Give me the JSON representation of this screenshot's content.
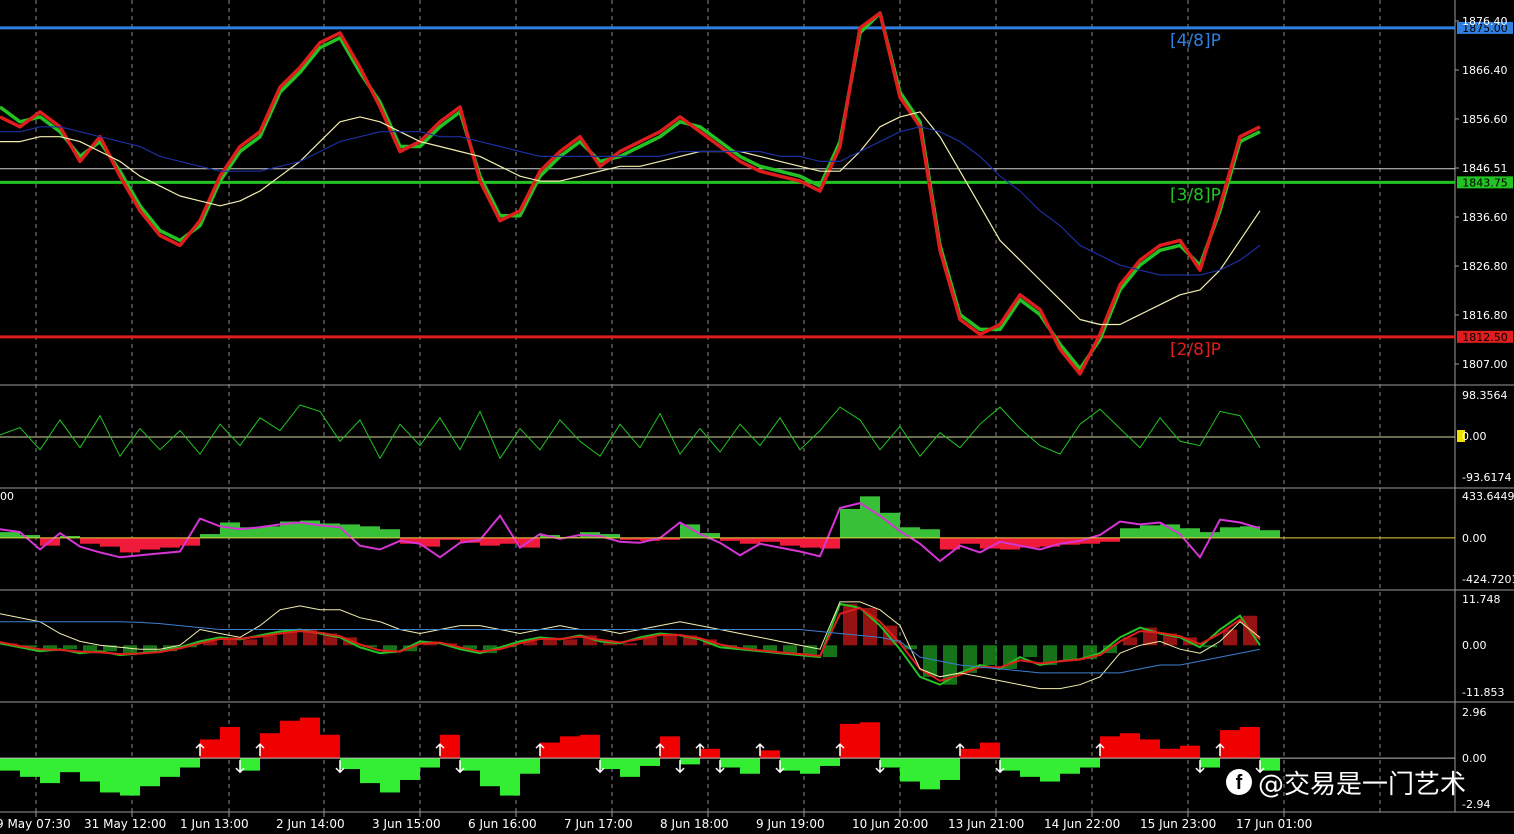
{
  "chart_data": [
    {
      "type": "line",
      "panel": "price",
      "ylim": [
        1800.5,
        1879
      ],
      "y_ticks": [
        "1876.40",
        "1866.40",
        "1856.60",
        "1846.51",
        "1836.60",
        "1826.80",
        "1816.80",
        "1807.00"
      ],
      "current_price": "1846.51",
      "grid": true,
      "levels": [
        {
          "label": "[4/8]P",
          "value": 1875.0,
          "tag": "1875.00",
          "color": "#2f7fe0"
        },
        {
          "label": "[3/8]P",
          "value": 1843.75,
          "tag": "1843.75",
          "color": "#22c322"
        },
        {
          "label": "[2/8]P",
          "value": 1812.5,
          "tag": "1812.50",
          "color": "#e01d1d"
        }
      ],
      "x": [
        0,
        20,
        40,
        60,
        80,
        100,
        120,
        140,
        160,
        180,
        200,
        220,
        240,
        260,
        280,
        300,
        320,
        340,
        360,
        380,
        400,
        420,
        440,
        460,
        480,
        500,
        520,
        540,
        560,
        580,
        600,
        620,
        640,
        660,
        680,
        700,
        720,
        740,
        760,
        780,
        800,
        820,
        840,
        860,
        880,
        900,
        920,
        940,
        960,
        980,
        1000,
        1020,
        1040,
        1060,
        1080,
        1100,
        1120,
        1140,
        1160,
        1180,
        1200,
        1220,
        1240,
        1260
      ],
      "series": [
        {
          "color": "#22c322",
          "values": [
            1859,
            1856,
            1857,
            1854,
            1849,
            1852,
            1846,
            1839,
            1834,
            1832,
            1835,
            1844,
            1850,
            1853,
            1862,
            1866,
            1871,
            1873,
            1866,
            1860,
            1851,
            1851,
            1855,
            1858,
            1845,
            1837,
            1837,
            1845,
            1849,
            1852,
            1848,
            1849,
            1851,
            1853,
            1856,
            1855,
            1852,
            1849,
            1847,
            1846,
            1845,
            1843,
            1852,
            1874,
            1878,
            1862,
            1856,
            1831,
            1817,
            1814,
            1814,
            1820,
            1817,
            1811,
            1806,
            1812,
            1822,
            1827,
            1830,
            1831,
            1827,
            1838,
            1852,
            1854
          ]
        },
        {
          "color": "#e01d1d",
          "values": [
            1857,
            1855,
            1858,
            1855,
            1848,
            1853,
            1845,
            1838,
            1833,
            1831,
            1836,
            1845,
            1851,
            1854,
            1863,
            1867,
            1872,
            1874,
            1867,
            1859,
            1850,
            1852,
            1856,
            1859,
            1844,
            1836,
            1838,
            1846,
            1850,
            1853,
            1847,
            1850,
            1852,
            1854,
            1857,
            1854,
            1851,
            1848,
            1846,
            1845,
            1844,
            1842,
            1851,
            1875,
            1878,
            1861,
            1855,
            1830,
            1816,
            1813,
            1815,
            1821,
            1818,
            1810,
            1805,
            1813,
            1823,
            1828,
            1831,
            1832,
            1826,
            1839,
            1853,
            1855
          ]
        },
        {
          "color": "#f4efb0",
          "values": [
            1852,
            1852,
            1853,
            1853,
            1852,
            1850,
            1848,
            1845,
            1843,
            1841,
            1840,
            1839,
            1840,
            1842,
            1845,
            1848,
            1852,
            1856,
            1857,
            1856,
            1854,
            1852,
            1851,
            1850,
            1849,
            1847,
            1845,
            1844,
            1844,
            1845,
            1846,
            1847,
            1847,
            1848,
            1849,
            1850,
            1850,
            1850,
            1849,
            1848,
            1847,
            1846,
            1846,
            1850,
            1855,
            1857,
            1858,
            1853,
            1846,
            1839,
            1832,
            1828,
            1824,
            1820,
            1816,
            1815,
            1815,
            1817,
            1819,
            1821,
            1822,
            1826,
            1832,
            1838
          ]
        },
        {
          "color": "#1c2e9e",
          "values": [
            1854,
            1854,
            1855,
            1855,
            1854,
            1853,
            1852,
            1851,
            1849,
            1848,
            1847,
            1846,
            1846,
            1846,
            1847,
            1848,
            1850,
            1852,
            1853,
            1854,
            1854,
            1854,
            1853,
            1853,
            1852,
            1851,
            1850,
            1849,
            1849,
            1849,
            1849,
            1849,
            1849,
            1849,
            1850,
            1850,
            1850,
            1850,
            1850,
            1849,
            1849,
            1848,
            1848,
            1850,
            1852,
            1854,
            1855,
            1854,
            1852,
            1849,
            1845,
            1842,
            1838,
            1835,
            1831,
            1829,
            1827,
            1826,
            1825,
            1825,
            1825,
            1826,
            1828,
            1831
          ]
        }
      ]
    },
    {
      "type": "line",
      "panel": "oscillator-1",
      "ylim": [
        -93.6174,
        98.3564
      ],
      "y_ticks": [
        "98.3564",
        "0.00",
        "-93.6174"
      ],
      "series": [
        {
          "color": "#22c322",
          "values": [
            5,
            22,
            -30,
            40,
            -25,
            50,
            -45,
            20,
            -30,
            15,
            -40,
            30,
            -20,
            45,
            15,
            75,
            60,
            -10,
            40,
            -50,
            30,
            -20,
            45,
            -30,
            60,
            -50,
            20,
            -30,
            40,
            -10,
            -45,
            30,
            -25,
            55,
            -40,
            20,
            -35,
            30,
            -20,
            45,
            -30,
            15,
            70,
            40,
            -30,
            25,
            -45,
            10,
            -25,
            30,
            70,
            20,
            -20,
            -40,
            30,
            65,
            20,
            -25,
            45,
            -10,
            -20,
            60,
            50,
            -25
          ]
        }
      ]
    },
    {
      "type": "area",
      "panel": "oscillator-2",
      "ylim": [
        -424.7201,
        433.6449
      ],
      "y_ticks": [
        "433.6449",
        "0.00",
        "-424.7201"
      ],
      "left_edge_label": "00",
      "series": [
        {
          "color": "#22c322",
          "values": [
            60,
            30,
            -80,
            20,
            -60,
            -90,
            -150,
            -120,
            -100,
            -80,
            40,
            160,
            110,
            120,
            170,
            180,
            150,
            140,
            120,
            90,
            -60,
            -90,
            -20,
            -50,
            -80,
            -60,
            -100,
            30,
            10,
            60,
            40,
            -20,
            -30,
            -20,
            140,
            50,
            -30,
            -60,
            -40,
            -80,
            -100,
            -110,
            300,
            430,
            260,
            110,
            90,
            -120,
            -60,
            -110,
            -120,
            -100,
            -90,
            -70,
            -60,
            -40,
            100,
            130,
            140,
            100,
            60,
            110,
            120,
            80
          ]
        },
        {
          "color": "#d535d5",
          "values": [
            90,
            60,
            -120,
            50,
            -90,
            -150,
            -200,
            -180,
            -160,
            -140,
            200,
            120,
            90,
            110,
            140,
            160,
            130,
            110,
            -80,
            -120,
            -30,
            -60,
            -200,
            -50,
            -20,
            230,
            -100,
            40,
            -10,
            30,
            20,
            -40,
            -50,
            0,
            160,
            40,
            -50,
            -180,
            -60,
            -100,
            -140,
            -190,
            310,
            360,
            230,
            70,
            -60,
            -240,
            -80,
            -150,
            -40,
            -80,
            -120,
            -60,
            -30,
            30,
            170,
            140,
            160,
            40,
            -200,
            190,
            160,
            100
          ]
        }
      ]
    },
    {
      "type": "line",
      "panel": "oscillator-3",
      "ylim": [
        -11.853,
        11.748
      ],
      "y_ticks": [
        "11.748",
        "0.00",
        "-11.853"
      ],
      "series": [
        {
          "color": "#22c322",
          "values": [
            0.5,
            -0.5,
            -1.5,
            -1,
            -2,
            -1.5,
            -2.5,
            -2,
            -1.5,
            -0.5,
            1,
            2,
            1.5,
            2.5,
            3.5,
            4,
            3,
            2,
            -0.5,
            -2,
            -1.5,
            1,
            0.5,
            -1,
            -2,
            -0.5,
            1,
            2,
            1.5,
            2.5,
            1,
            0.5,
            2,
            3,
            2.5,
            1.5,
            -0.5,
            -1,
            -1.5,
            -2,
            -2.5,
            -3,
            10.5,
            9.5,
            5,
            -1,
            -8,
            -10,
            -7,
            -5,
            -6,
            -3,
            -5,
            -4,
            -3.5,
            -2,
            2,
            4.5,
            3,
            2,
            -0.5,
            4,
            7.5,
            0
          ]
        },
        {
          "color": "#e01d1d",
          "values": [
            0.8,
            -0.2,
            -1,
            -1.2,
            -1.6,
            -1.8,
            -2.2,
            -2.1,
            -1.7,
            -0.8,
            0.5,
            1.6,
            1.7,
            2.2,
            3,
            3.6,
            3.2,
            2.3,
            0.2,
            -1.3,
            -1.6,
            0.4,
            0.7,
            -0.5,
            -1.6,
            -1,
            0.5,
            1.6,
            1.6,
            2.2,
            1.4,
            0.7,
            1.6,
            2.6,
            2.6,
            1.8,
            0.2,
            -0.7,
            -1.3,
            -1.8,
            -2.2,
            -2.7,
            8,
            9.5,
            6,
            0.5,
            -6,
            -9,
            -7.5,
            -5.5,
            -5.6,
            -3.8,
            -4.6,
            -4.1,
            -3.6,
            -2.5,
            1,
            3.6,
            3.2,
            2.3,
            0.3,
            3,
            6.5,
            1.5
          ]
        },
        {
          "color": "#f4efb0",
          "values": [
            8,
            7,
            6,
            3,
            1,
            0,
            -0.5,
            -1,
            -1,
            0,
            4,
            3,
            2,
            5,
            9,
            10,
            9,
            9,
            7,
            6,
            4,
            3,
            4,
            5,
            5,
            4,
            3,
            4,
            5,
            4,
            4,
            3,
            4,
            5,
            6,
            5,
            4,
            3,
            2,
            1,
            0,
            -1,
            11,
            11,
            9,
            5,
            -6,
            -8,
            -7,
            -8,
            -9,
            -10,
            -11,
            -11,
            -10,
            -8,
            -2,
            0,
            1,
            -1,
            -2,
            1,
            6,
            2
          ]
        },
        {
          "color": "#3a7fd0",
          "values": [
            6,
            6,
            6,
            6,
            6,
            6,
            6,
            5.8,
            5.5,
            5,
            4.5,
            4,
            4,
            4,
            4,
            4,
            4,
            4,
            4,
            4,
            4,
            4,
            4,
            4,
            4,
            4,
            4,
            4,
            4,
            4,
            4,
            4,
            4,
            4,
            4,
            4,
            4,
            4,
            4,
            4,
            4,
            3.5,
            3,
            2.5,
            2,
            1,
            -3,
            -4,
            -5,
            -5.5,
            -6,
            -6.5,
            -7,
            -7,
            -7,
            -7,
            -7,
            -6,
            -5,
            -5,
            -4,
            -3,
            -2,
            -1
          ]
        }
      ]
    },
    {
      "type": "area",
      "panel": "oscillator-4",
      "ylim": [
        -2.94,
        2.96
      ],
      "y_ticks": [
        "2.96",
        "0.00",
        "-2.94"
      ],
      "series": [
        {
          "color": "#33ee33",
          "values": [
            -0.8,
            -1.2,
            -1.6,
            -0.9,
            -1.5,
            -2.2,
            -2.4,
            -1.8,
            -1.2,
            -0.6,
            1.2,
            2.0,
            -0.8,
            1.6,
            2.4,
            2.6,
            1.5,
            -0.7,
            -1.6,
            -2.2,
            -1.4,
            -0.6,
            1.5,
            -0.8,
            -1.8,
            -2.4,
            -1.0,
            1.0,
            1.4,
            1.5,
            -0.7,
            -1.2,
            -0.5,
            1.4,
            -0.4,
            0.6,
            -0.6,
            -1.0,
            0.5,
            -0.8,
            -1.0,
            -0.5,
            2.2,
            2.3,
            -0.6,
            -1.5,
            -2.0,
            -1.4,
            0.6,
            1.0,
            -0.8,
            -1.2,
            -1.5,
            -1.0,
            -0.6,
            1.4,
            1.6,
            1.2,
            0.6,
            0.8,
            -0.6,
            1.8,
            2.0,
            -0.8
          ]
        }
      ]
    },
    {
      "type": "table",
      "panel": "time-axis",
      "x_tick_labels": [
        "9 May 07:30",
        "31 May 12:00",
        "1 Jun 13:00",
        "2 Jun 14:00",
        "3 Jun 15:00",
        "6 Jun 16:00",
        "7 Jun 17:00",
        "8 Jun 18:00",
        "9 Jun 19:00",
        "10 Jun 20:00",
        "13 Jun 21:00",
        "14 Jun 22:00",
        "15 Jun 23:00",
        "17 Jun 01:00"
      ]
    }
  ],
  "watermark": {
    "text": "@交易是一门艺术",
    "icon": "facebook-logo-icon"
  }
}
